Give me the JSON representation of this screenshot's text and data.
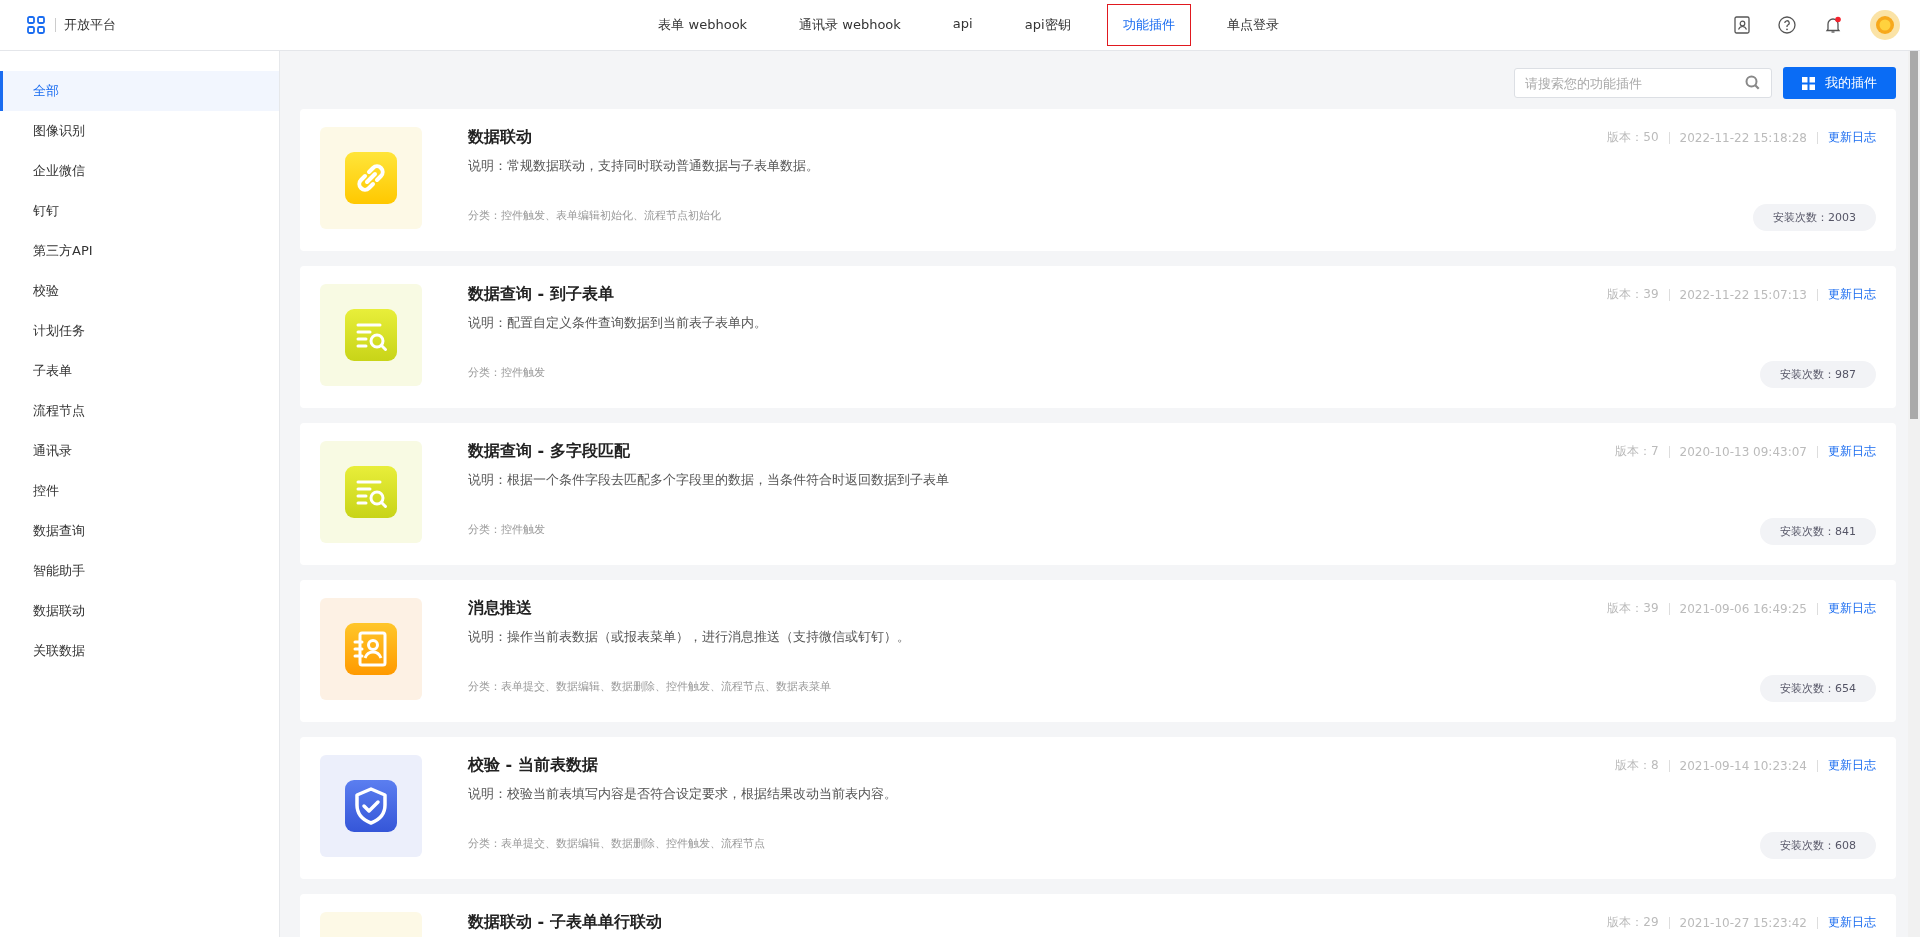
{
  "header": {
    "title": "开放平台",
    "tabs": [
      {
        "label": "表单 webhook",
        "selected": false
      },
      {
        "label": "通讯录 webhook",
        "selected": false
      },
      {
        "label": "api",
        "selected": false
      },
      {
        "label": "api密钥",
        "selected": false
      },
      {
        "label": "功能插件",
        "selected": true
      },
      {
        "label": "单点登录",
        "selected": false
      }
    ],
    "notification_dot": true
  },
  "sidebar": {
    "items": [
      {
        "label": "全部",
        "selected": true
      },
      {
        "label": "图像识别",
        "selected": false
      },
      {
        "label": "企业微信",
        "selected": false
      },
      {
        "label": "钉钉",
        "selected": false
      },
      {
        "label": "第三方API",
        "selected": false
      },
      {
        "label": "校验",
        "selected": false
      },
      {
        "label": "计划任务",
        "selected": false
      },
      {
        "label": "子表单",
        "selected": false
      },
      {
        "label": "流程节点",
        "selected": false
      },
      {
        "label": "通讯录",
        "selected": false
      },
      {
        "label": "控件",
        "selected": false
      },
      {
        "label": "数据查询",
        "selected": false
      },
      {
        "label": "智能助手",
        "selected": false
      },
      {
        "label": "数据联动",
        "selected": false
      },
      {
        "label": "关联数据",
        "selected": false
      }
    ]
  },
  "search": {
    "placeholder": "请搜索您的功能插件"
  },
  "my_plugins_button": "我的插件",
  "plugins": [
    {
      "kind": "link",
      "title": "数据联动",
      "description": "说明：常规数据联动，支持同时联动普通数据与子表单数据。",
      "category": "分类：控件触发、表单编辑初始化、流程节点初始化",
      "version": "版本：50",
      "date": "2022-11-22 15:18:28",
      "log": "更新日志",
      "installs": "安装次数：2003"
    },
    {
      "kind": "query",
      "title": "数据查询 - 到子表单",
      "description": "说明：配置自定义条件查询数据到当前表子表单内。",
      "category": "分类：控件触发",
      "version": "版本：39",
      "date": "2022-11-22 15:07:13",
      "log": "更新日志",
      "installs": "安装次数：987"
    },
    {
      "kind": "query",
      "title": "数据查询 - 多字段匹配",
      "description": "说明：根据一个条件字段去匹配多个字段里的数据，当条件符合时返回数据到子表单",
      "category": "分类：控件触发",
      "version": "版本：7",
      "date": "2020-10-13 09:43:07",
      "log": "更新日志",
      "installs": "安装次数：841"
    },
    {
      "kind": "contact",
      "title": "消息推送",
      "description": "说明：操作当前表数据（或报表菜单），进行消息推送（支持微信或钉钉）。",
      "category": "分类：表单提交、数据编辑、数据删除、控件触发、流程节点、数据表菜单",
      "version": "版本：39",
      "date": "2021-09-06 16:49:25",
      "log": "更新日志",
      "installs": "安装次数：654"
    },
    {
      "kind": "shield",
      "title": "校验 - 当前表数据",
      "description": "说明：校验当前表填写内容是否符合设定要求，根据结果改动当前表内容。",
      "category": "分类：表单提交、数据编辑、数据删除、控件触发、流程节点",
      "version": "版本：8",
      "date": "2021-09-14 10:23:24",
      "log": "更新日志",
      "installs": "安装次数：608"
    },
    {
      "title": "数据联动 - 子表单单行联动",
      "version": "版本：29",
      "date": "2021-10-27 15:23:42",
      "log": "更新日志"
    }
  ]
}
